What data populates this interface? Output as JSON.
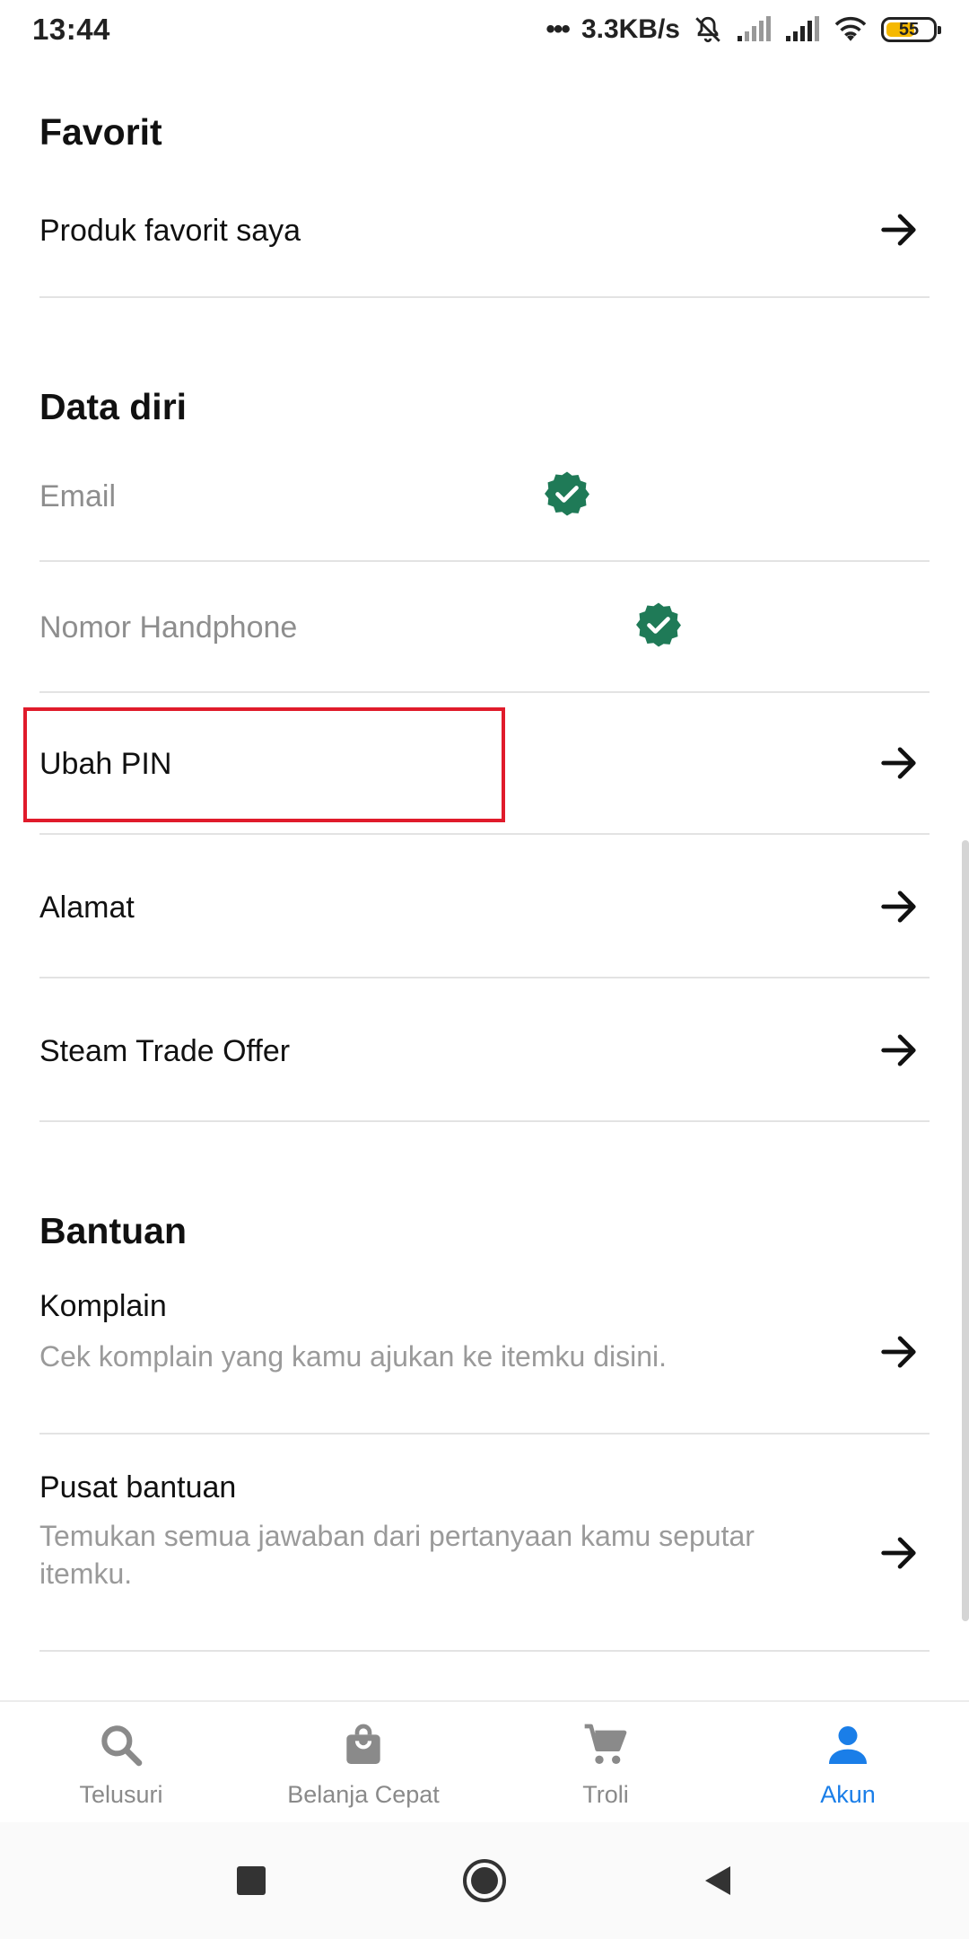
{
  "status_bar": {
    "time": "13:44",
    "dots": "•••",
    "network_speed": "3.3KB/s",
    "battery": "55"
  },
  "sections": {
    "favorit": {
      "title": "Favorit",
      "items": [
        {
          "label": "Produk favorit saya",
          "icon": "arrow-right-icon"
        }
      ]
    },
    "data_diri": {
      "title": "Data diri",
      "items": [
        {
          "label": "Email",
          "status": "verified",
          "icon": "verified-badge-icon"
        },
        {
          "label": "Nomor Handphone",
          "status": "verified",
          "icon": "verified-badge-icon"
        },
        {
          "label": "Ubah PIN",
          "icon": "arrow-right-icon",
          "highlighted": true
        },
        {
          "label": "Alamat",
          "icon": "arrow-right-icon"
        },
        {
          "label": "Steam Trade Offer",
          "icon": "arrow-right-icon"
        }
      ]
    },
    "bantuan": {
      "title": "Bantuan",
      "items": [
        {
          "label": "Komplain",
          "description": "Cek komplain yang kamu ajukan ke itemku disini.",
          "icon": "arrow-right-icon"
        },
        {
          "label": "Pusat bantuan",
          "description": "Temukan semua jawaban dari pertanyaan kamu seputar itemku.",
          "icon": "arrow-right-icon"
        }
      ]
    }
  },
  "bottom_nav": [
    {
      "label": "Telusuri",
      "icon": "search-icon",
      "active": false
    },
    {
      "label": "Belanja Cepat",
      "icon": "shopping-bag-icon",
      "active": false
    },
    {
      "label": "Troli",
      "icon": "cart-icon",
      "active": false
    },
    {
      "label": "Akun",
      "icon": "person-icon",
      "active": true
    }
  ],
  "colors": {
    "accent": "#1a7ee8",
    "verified": "#1f7a57",
    "highlight": "#e01b2b",
    "muted_text": "#8e8e8e",
    "divider": "#e3e3e3"
  }
}
